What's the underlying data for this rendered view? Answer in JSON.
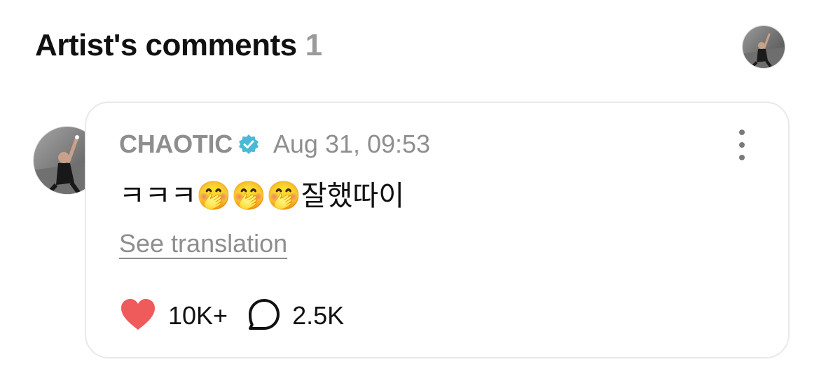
{
  "section": {
    "title": "Artist's comments",
    "count": "1"
  },
  "comment": {
    "username": "CHAOTIC",
    "verified": true,
    "timestamp": "Aug 31, 09:53",
    "text": "ㅋㅋㅋ🤭🤭🤭잘했따이",
    "see_translation_label": "See translation",
    "likes_count": "10K+",
    "replies_count": "2.5K"
  },
  "icons": {
    "like": "heart-icon",
    "reply": "speech-bubble-icon",
    "verified": "verified-badge-icon",
    "more": "more-vertical-icon"
  },
  "colors": {
    "like": "#ef5a5a",
    "verified": "#4bb8d6",
    "muted_text": "#8e8e8e",
    "card_border": "#e9e9e9"
  }
}
